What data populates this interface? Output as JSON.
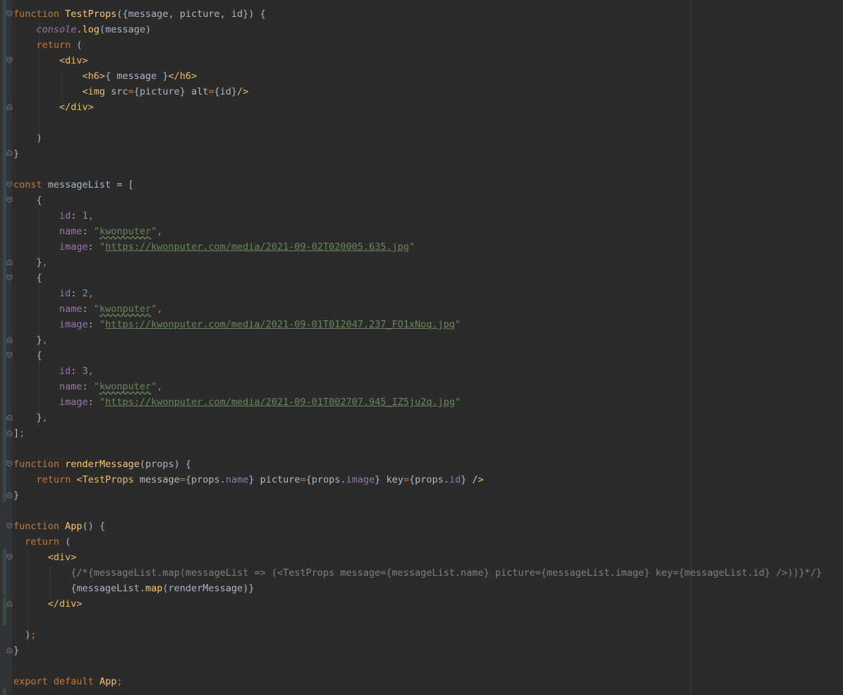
{
  "editor": {
    "language": "JavaScript (JSX)",
    "colors": {
      "background": "#2b2b2b",
      "gutter": "#313335",
      "keyword": "#cc7832",
      "function_name": "#ffc66d",
      "property": "#9876aa",
      "number": "#6897bb",
      "string": "#6a8759",
      "jsx_tag": "#e8bf6a",
      "comment": "#808080",
      "plain": "#a9b7c6"
    }
  },
  "code": {
    "l1": {
      "kw": "function",
      "name": "TestProps",
      "args": "({message, picture, id}) {"
    },
    "l2": {
      "obj": "console",
      "dot": ".",
      "method": "log",
      "rest": "(message)"
    },
    "l3": {
      "kw": "return",
      "rest": " ("
    },
    "l4": {
      "open": "<div>"
    },
    "l5": {
      "open": "<h6>",
      "expr": "{ message }",
      "close": "</h6>"
    },
    "l6": {
      "open": "<img",
      "a1": " src",
      "eq1": "=",
      "v1": "{picture}",
      "a2": " alt",
      "eq2": "=",
      "v2": "{id}",
      "end": "/>"
    },
    "l7": {
      "close": "</div>"
    },
    "l8": {
      "text": ")"
    },
    "l9": {
      "text": "}"
    },
    "l10": {
      "kw": "const",
      "rest": " messageList = ["
    },
    "obj_open": "{",
    "obj_close": "},",
    "obj_close_brace": "}",
    "obj_close_comma": ",",
    "items": [
      {
        "id_key": "id",
        "id_val": "1",
        "name_key": "name",
        "name_val": "kwonputer",
        "image_key": "image",
        "image_val": "https://kwonputer.com/media/2021-09-02T020005.635.jpg"
      },
      {
        "id_key": "id",
        "id_val": "2",
        "name_key": "name",
        "name_val": "kwonputer",
        "image_key": "image",
        "image_val": "https://kwonputer.com/media/2021-09-01T012047.237_FO1xNoq.jpg"
      },
      {
        "id_key": "id",
        "id_val": "3",
        "name_key": "name",
        "name_val": "kwonputer",
        "image_key": "image",
        "image_val": "https://kwonputer.com/media/2021-09-01T002707.945_IZ5ju2q.jpg"
      }
    ],
    "array_close": "]",
    "semicolon": ";",
    "colon": ": ",
    "comma": ",",
    "quote": "\"",
    "l_rm": {
      "kw": "function",
      "name": "renderMessage",
      "args": "(props) {"
    },
    "l_rm_ret": {
      "kw": "return",
      "tag": "<TestProps",
      "a1": " message",
      "eq": "=",
      "v1a": "{props.",
      "v1b": "name",
      "v1c": "}",
      "a2": " picture",
      "v2a": "{props.",
      "v2b": "image",
      "v2c": "}",
      "a3": " key",
      "v3a": "{props.",
      "v3b": "id",
      "v3c": "}",
      "end": " />"
    },
    "l_rm_close": "}",
    "l_app": {
      "kw": "function",
      "name": "App",
      "args": "() {"
    },
    "l_app_ret": {
      "kw": "return",
      "rest": " ("
    },
    "l_app_div": "<div>",
    "l_app_comment": "{/*{messageList.map(messageList => (<TestProps message={messageList.name} picture={messageList.image} key={messageList.id} />))}*/}",
    "l_app_map": {
      "a": "{messageList.",
      "b": "map",
      "c": "(",
      "d": "renderMessage",
      "e": ")}"
    },
    "l_app_div_close": "</div>",
    "l_app_paren": ")",
    "l_app_semi": ";",
    "l_app_close": "}",
    "l_export": {
      "kw1": "export",
      "kw2": " default",
      "name": " App",
      "semi": ";"
    }
  }
}
